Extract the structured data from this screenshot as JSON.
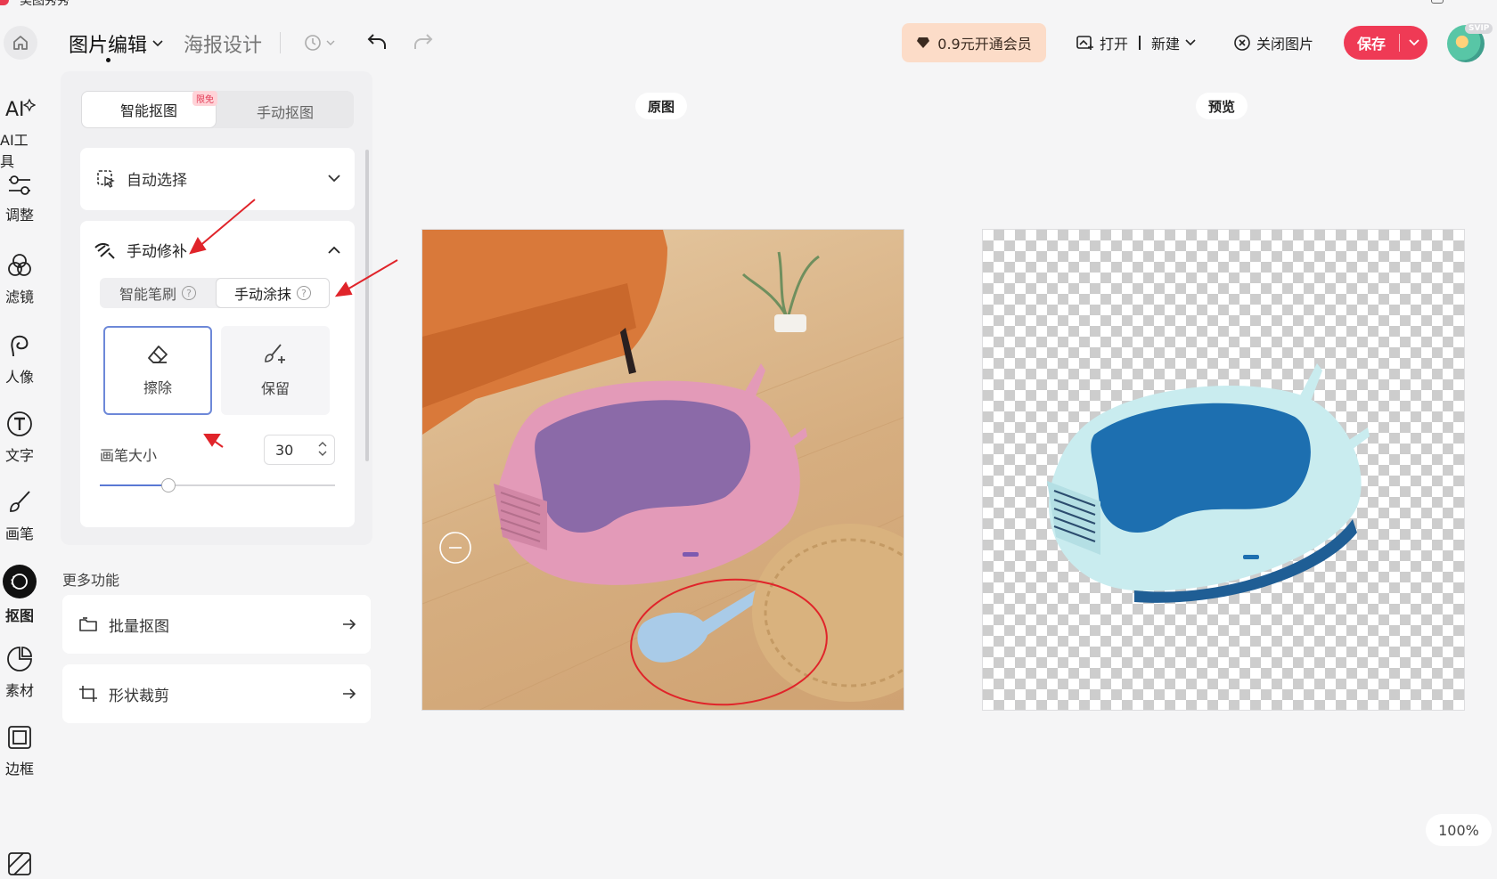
{
  "app": {
    "name": "美图秀秀"
  },
  "topbar": {
    "title": "图片编辑",
    "poster": "海报设计",
    "vip_label": "0.9元开通会员",
    "open_label": "打开",
    "new_label": "新建",
    "close_image_label": "关闭图片",
    "save_label": "保存",
    "avatar_badge": "SVIP"
  },
  "rail": {
    "items": [
      {
        "label": "AI工具",
        "icon": "ai-icon"
      },
      {
        "label": "调整",
        "icon": "adjust-icon"
      },
      {
        "label": "滤镜",
        "icon": "filter-icon"
      },
      {
        "label": "人像",
        "icon": "portrait-icon"
      },
      {
        "label": "文字",
        "icon": "text-icon"
      },
      {
        "label": "画笔",
        "icon": "brush-icon"
      },
      {
        "label": "抠图",
        "icon": "cutout-icon",
        "active": true
      },
      {
        "label": "素材",
        "icon": "sticker-icon"
      },
      {
        "label": "边框",
        "icon": "frame-icon"
      }
    ]
  },
  "panel": {
    "tab_smart": "智能抠图",
    "tab_smart_badge": "限免",
    "tab_manual": "手动抠图",
    "auto_select": "自动选择",
    "manual_fix": "手动修补",
    "sub_smart_brush": "智能笔刷",
    "sub_manual_paint": "手动涂抹",
    "help_glyph": "?",
    "tool_erase": "擦除",
    "tool_keep": "保留",
    "brush_size_label": "画笔大小",
    "brush_size_value": "30",
    "brush_size_fraction": 0.29
  },
  "more": {
    "title": "更多功能",
    "batch": "批量抠图",
    "shape_crop": "形状裁剪"
  },
  "canvas": {
    "original_label": "原图",
    "preview_label": "预览",
    "zoom": "100%"
  },
  "colors": {
    "accent": "#ef3a55",
    "vip_bg": "#fcdcc8",
    "selection": "#6d88d8",
    "annotation_red": "#e0242a"
  }
}
